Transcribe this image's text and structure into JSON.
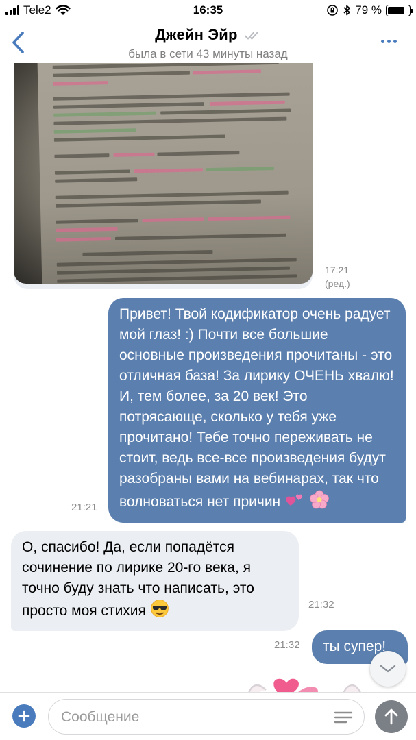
{
  "status_bar": {
    "carrier": "Tele2",
    "time": "16:35",
    "battery_percent": "79 %",
    "battery_level": 0.79
  },
  "header": {
    "title": "Джейн Эйр",
    "subtitle": "была в сети 43 минуты назад",
    "back_icon": "chevron-left-icon",
    "more_icon": "more-dots-icon",
    "accent_color": "#4a7cbd"
  },
  "messages": [
    {
      "type": "photo",
      "direction": "in",
      "time": "17:21",
      "edited": "(ред.)"
    },
    {
      "type": "text",
      "direction": "out",
      "text": "Привет! Твой кодификатор очень радует мой глаз! :) Почти все большие основные произведения прочитаны - это отличная база! За лирику ОЧЕНЬ хвалю! И, тем более, за 20 век! Это потрясающе, сколько у тебя уже прочитано! Тебе точно переживать не стоит, ведь все-все произведения будут разобраны вами на вебинарах, так что волноваться нет причин",
      "emojis": [
        "💕",
        "🌸"
      ],
      "time": "21:21",
      "bubble_color": "#5b7fae"
    },
    {
      "type": "text",
      "direction": "in",
      "text": "О, спасибо! Да, если попадётся сочинение по лирике 20-го века, я точно буду знать что написать, это просто моя стихия",
      "emojis": [
        "😎"
      ],
      "time": "21:32",
      "bubble_color": "#ebeef2"
    },
    {
      "type": "text",
      "direction": "out",
      "text": "ты супер!",
      "time": "21:32"
    }
  ],
  "input": {
    "placeholder": "Сообщение",
    "value": "",
    "attach_icon": "plus-icon",
    "keyboard_icon": "keyboard-icon",
    "send_icon": "arrow-up-icon"
  },
  "scroll_down_icon": "chevron-down-icon"
}
